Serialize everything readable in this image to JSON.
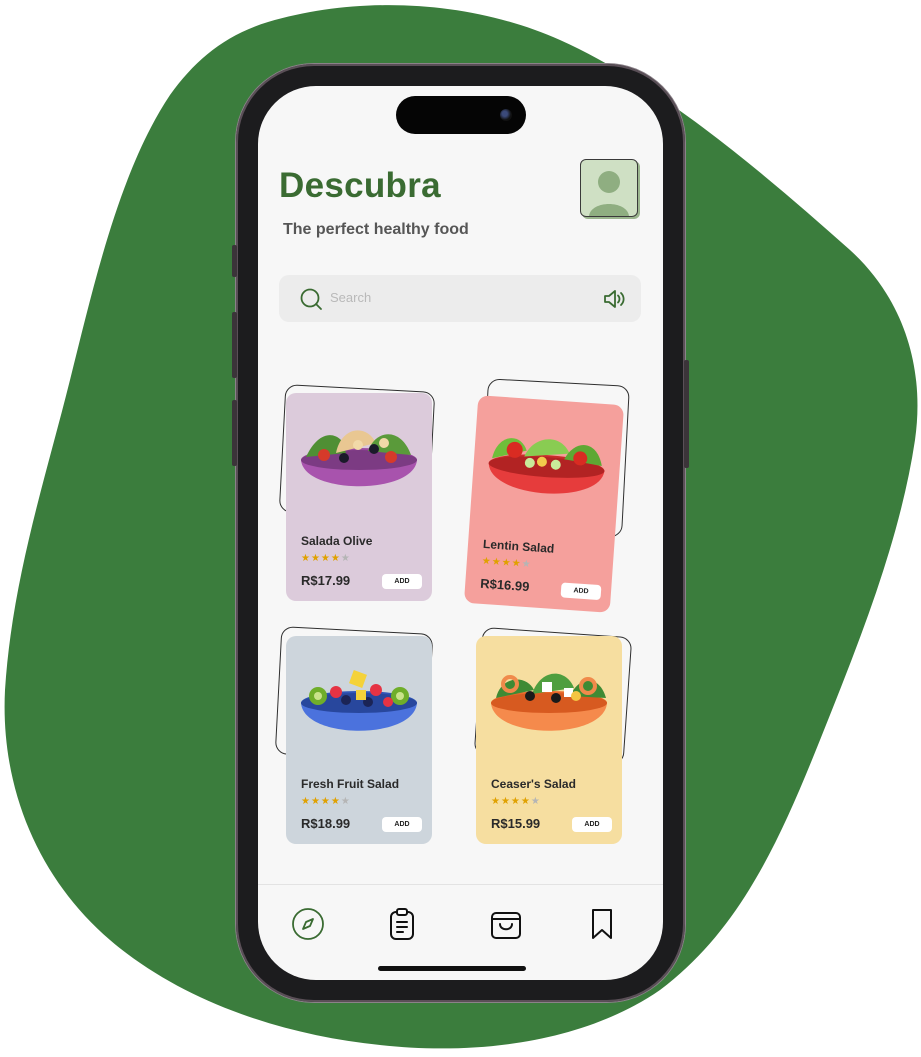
{
  "colors": {
    "brand_green": "#3a7d3c",
    "title_green": "#3a6b32",
    "star_on": "#e0a100",
    "star_off": "#b5b5b5"
  },
  "header": {
    "title": "Descubra",
    "subtitle": "The perfect healthy food",
    "avatar_icon": "user-avatar-icon"
  },
  "search": {
    "placeholder": "Search",
    "left_icon": "search-icon",
    "right_icon": "speaker-icon"
  },
  "products": [
    {
      "name": "Salada Olive",
      "price": "R$17.99",
      "rating": 4,
      "rating_max": 5,
      "add_label": "ADD",
      "card_color": "#dccbdb"
    },
    {
      "name": "Lentin Salad",
      "price": "R$16.99",
      "rating": 4,
      "rating_max": 5,
      "add_label": "ADD",
      "card_color": "#f5a09c"
    },
    {
      "name": "Fresh Fruit Salad",
      "price": "R$18.99",
      "rating": 4,
      "rating_max": 5,
      "add_label": "ADD",
      "card_color": "#cdd5dc"
    },
    {
      "name": "Ceaser's Salad",
      "price": "R$15.99",
      "rating": 4,
      "rating_max": 5,
      "add_label": "ADD",
      "card_color": "#f6dea0"
    }
  ],
  "bottom_nav": {
    "items": [
      {
        "icon": "compass-icon",
        "active": true
      },
      {
        "icon": "clipboard-icon",
        "active": false
      },
      {
        "icon": "shopping-bag-icon",
        "active": false
      },
      {
        "icon": "bookmark-icon",
        "active": false
      }
    ]
  }
}
